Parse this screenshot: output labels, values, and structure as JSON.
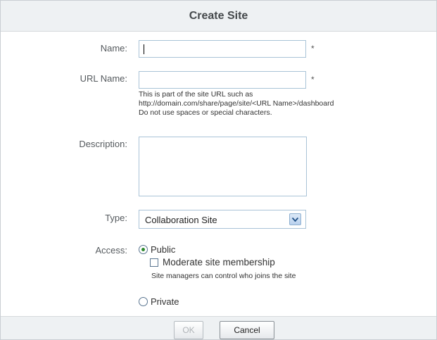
{
  "dialog": {
    "title": "Create Site"
  },
  "form": {
    "name": {
      "label": "Name:",
      "value": "",
      "required_mark": "*"
    },
    "url_name": {
      "label": "URL Name:",
      "value": "",
      "required_mark": "*",
      "help_lines": [
        "This is part of the site URL such as",
        "http://domain.com/share/page/site/<URL Name>/dashboard",
        "Do not use spaces or special characters."
      ]
    },
    "description": {
      "label": "Description:",
      "value": ""
    },
    "type": {
      "label": "Type:",
      "selected": "Collaboration Site",
      "arrow_icon": "chevron-down-icon"
    },
    "access": {
      "label": "Access:",
      "public_label": "Public",
      "public_selected": true,
      "moderate_label": "Moderate site membership",
      "moderate_checked": false,
      "moderate_help": "Site managers can control who joins the site",
      "private_label": "Private",
      "private_selected": false
    }
  },
  "footer": {
    "ok_label": "OK",
    "ok_enabled": false,
    "cancel_label": "Cancel"
  },
  "colors": {
    "header_bg": "#eef1f3",
    "input_border": "#a9c3d7",
    "radio_selected": "#2f8a2f"
  }
}
